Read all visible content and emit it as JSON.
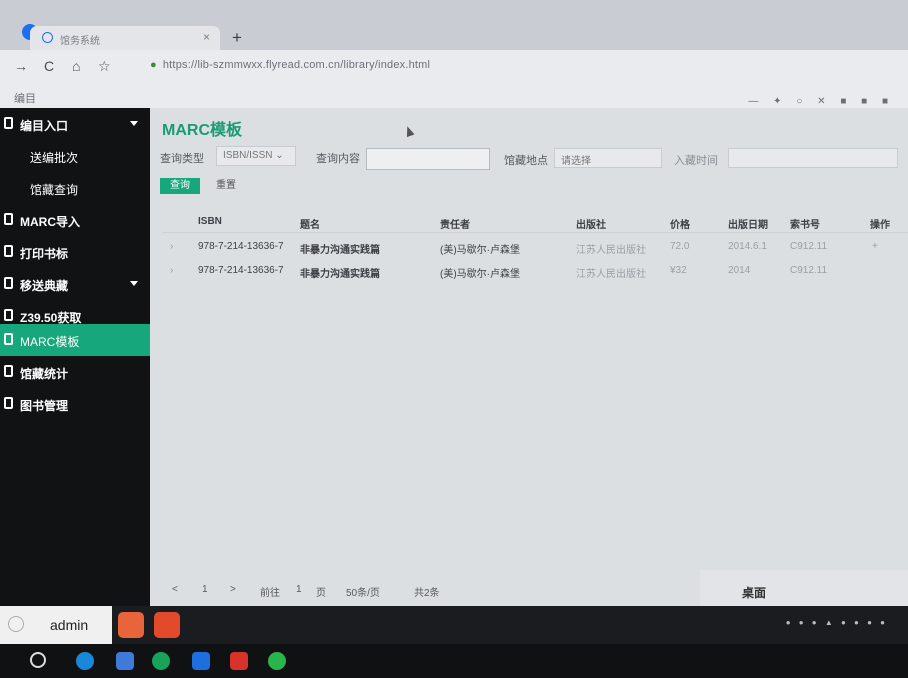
{
  "browser": {
    "tab_title": "馆务系统",
    "url": "https://lib-szmmwxx.flyread.com.cn/library/index.html",
    "bookmark": "编目"
  },
  "sidebar": {
    "items": [
      {
        "label": "编目入口",
        "caret": true,
        "sub": false
      },
      {
        "label": "送编批次",
        "caret": false,
        "sub": true
      },
      {
        "label": "馆藏查询",
        "caret": false,
        "sub": true
      },
      {
        "label": "MARC导入",
        "caret": false,
        "sub": false
      },
      {
        "label": "打印书标",
        "caret": false,
        "sub": false
      },
      {
        "label": "移送典藏",
        "caret": true,
        "sub": false
      },
      {
        "label": "Z39.50获取",
        "caret": false,
        "sub": false
      },
      {
        "label": "MARC模板",
        "caret": false,
        "sub": false,
        "active": true
      },
      {
        "label": "馆藏统计",
        "caret": false,
        "sub": false
      },
      {
        "label": "图书管理",
        "caret": false,
        "sub": false
      }
    ]
  },
  "main": {
    "title": "MARC模板",
    "filters": {
      "query_type_label": "查询类型",
      "query_type_value": "ISBN/ISSN",
      "query_content_label": "查询内容",
      "location_label": "馆藏地点",
      "location_value": "请选择",
      "date_label": "入藏时间",
      "search_button": "查询",
      "reset_button": "重置"
    },
    "table": {
      "headers": [
        "ISBN",
        "题名",
        "责任者",
        "出版社",
        "价格",
        "出版日期",
        "索书号",
        "操作"
      ],
      "rows": [
        [
          "978-7-214-13636-7",
          "非暴力沟通实践篇",
          "(美)马歇尔·卢森堡",
          "江苏人民出版社",
          "72.0",
          "2014.6.1",
          "C912.11",
          "+"
        ],
        [
          "978-7-214-13636-7",
          "非暴力沟通实践篇",
          "(美)马歇尔·卢森堡",
          "江苏人民出版社",
          "¥32",
          "2014",
          "C912.11",
          ""
        ]
      ]
    },
    "pagination": {
      "prev": "<",
      "page": "1",
      "next": ">",
      "goto": "前往",
      "goto_page": "1",
      "page_unit": "页",
      "page_size": "50条/页",
      "total": "共2条"
    }
  },
  "right_panel": {
    "label": "桌面"
  },
  "dock": {
    "user": "admin"
  }
}
